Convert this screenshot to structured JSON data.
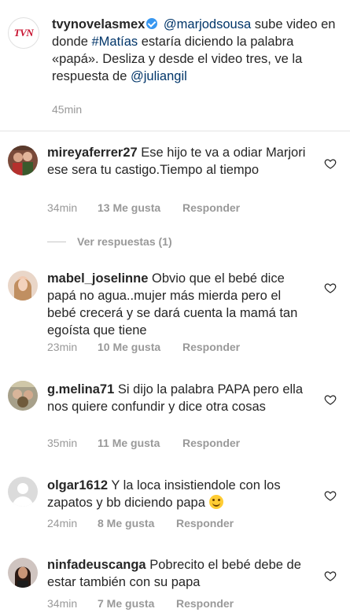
{
  "post": {
    "logo_text": "TVN",
    "username": "tvynovelasmex",
    "mention": "@marjodsousa",
    "text_1": " sube video en donde ",
    "hashtag": "#Matías",
    "text_2": " estaría diciendo la palabra «papá». Desliza y desde el video tres, ve la respuesta de ",
    "mention_2": "@juliangil",
    "time": "45min"
  },
  "replies_toggle": {
    "label": "Ver respuestas (1)"
  },
  "comments": [
    {
      "username": "mireyaferrer27",
      "text": "Ese hijo te va a odiar Marjori ese sera tu castigo.Tiempo al tiempo",
      "time": "34min",
      "likes": "13 Me gusta",
      "reply": "Responder"
    },
    {
      "username": "mabel_joselinne",
      "text": "Obvio que el bebé dice papá no agua..mujer más mierda pero el bebé crecerá y se dará cuenta la mamá tan egoísta que tiene",
      "time": "23min",
      "likes": "10 Me gusta",
      "reply": "Responder"
    },
    {
      "username": "g.melina71",
      "text": "Si dijo la palabra PAPA pero ella nos quiere confundir y dice otra cosas",
      "time": "35min",
      "likes": "11 Me gusta",
      "reply": "Responder"
    },
    {
      "username": "olgar1612",
      "text": "Y la loca insistiendole con los zapatos y bb diciendo papa ",
      "time": "24min",
      "likes": "8 Me gusta",
      "reply": "Responder"
    },
    {
      "username": "ninfadeuscanga",
      "text": "Pobrecito el bebé debe de estar también con su papa",
      "time": "34min",
      "likes": "7 Me gusta",
      "reply": "Responder"
    }
  ],
  "icons": {
    "like": "heart-outline-icon",
    "verified": "verified-badge-icon",
    "emoji": "smiling-face-emoji"
  },
  "colors": {
    "link": "#003569",
    "meta": "#999999",
    "verified": "#3897f0"
  }
}
